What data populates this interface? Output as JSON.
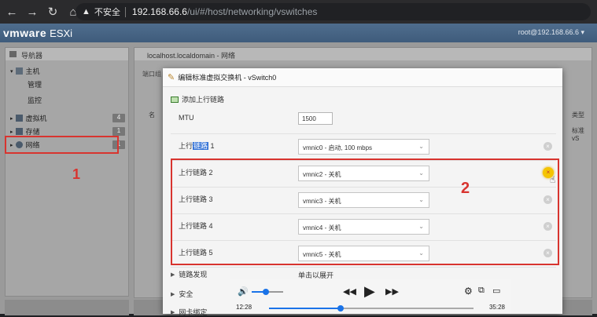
{
  "browser": {
    "security_text": "不安全",
    "url_host": "192.168.66.6",
    "url_path": "/ui/#/host/networking/vswitches"
  },
  "esxi": {
    "logo": "vmware",
    "product": "ESXi",
    "user": "root@192.168.66.6 ▾"
  },
  "navigator": {
    "title": "导航器",
    "host_label": "主机",
    "host_children": [
      "管理",
      "监控"
    ],
    "items": [
      {
        "label": "虚拟机",
        "badge": "4"
      },
      {
        "label": "存储",
        "badge": "1"
      },
      {
        "label": "网络",
        "badge": "1"
      }
    ]
  },
  "content": {
    "title": "localhost.localdomain - 网络",
    "tab_fragment": "端口组",
    "col_name": "名",
    "col_type": "类型",
    "row_type": "标准 vS"
  },
  "dialog": {
    "title": "编辑标准虚拟交换机 - vSwitch0",
    "add_uplink": "添加上行链路",
    "mtu_label": "MTU",
    "mtu_value": "1500",
    "uplinks": [
      {
        "label_prefix": "上行",
        "label_selected": "链路",
        "label_suffix": " 1",
        "value": "vmnic0 - 启动, 100 mbps"
      },
      {
        "label": "上行链路 2",
        "value": "vmnic2 - 关机"
      },
      {
        "label": "上行链路 3",
        "value": "vmnic3 - 关机"
      },
      {
        "label": "上行链路 4",
        "value": "vmnic4 - 关机"
      },
      {
        "label": "上行链路 5",
        "value": "vmnic5 - 关机"
      }
    ],
    "sections": [
      "链路发现",
      "安全",
      "网卡绑定"
    ],
    "expand_hint": "单击以展开"
  },
  "annotations": {
    "num1": "1",
    "num2": "2",
    "color": "#d8342f"
  },
  "media": {
    "current_time": "12:28",
    "total_time": "35:28",
    "progress": 0.35,
    "volume": 0.45
  }
}
